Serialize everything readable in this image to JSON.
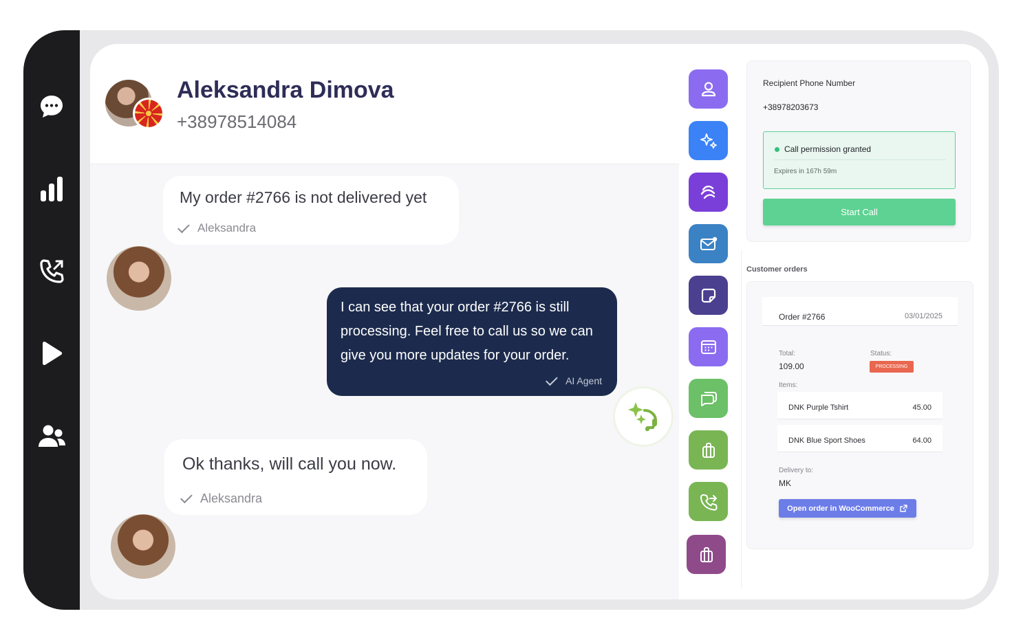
{
  "rail": {
    "icons": [
      "chat-bubble-icon",
      "bar-chart-icon",
      "phone-outgoing-icon",
      "play-icon",
      "users-icon"
    ]
  },
  "contact": {
    "name": "Aleksandra Dimova",
    "phone": "+38978514084"
  },
  "messages": [
    {
      "text": "My order #2766 is not delivered yet",
      "sender": "Aleksandra"
    },
    {
      "text": "I can see that your order #2766 is still processing. Feel free to call us so we can give you more updates for your order.",
      "sender": "AI Agent"
    },
    {
      "text": "Ok thanks, will call you now.",
      "sender": "Aleksandra"
    }
  ],
  "apps": [
    {
      "icon": "user-icon",
      "color": "#8b6cf0"
    },
    {
      "icon": "sparkles-icon",
      "color": "#3b82f6"
    },
    {
      "icon": "stripe-icon",
      "color": "#7b3fd9"
    },
    {
      "icon": "mail-icon",
      "color": "#3b82c4"
    },
    {
      "icon": "sticky-note-icon",
      "color": "#4b3f8f"
    },
    {
      "icon": "calendar-icon",
      "color": "#8b6cf0"
    },
    {
      "icon": "chat-icon",
      "color": "#6cc067"
    },
    {
      "icon": "gift-icon",
      "color": "#7ab554"
    },
    {
      "icon": "phone-forward-icon",
      "color": "#7ab554"
    },
    {
      "icon": "gift-icon",
      "color": "#8f4a8a"
    }
  ],
  "call": {
    "recipient_label": "Recipient Phone Number",
    "recipient_phone": "+38978203673",
    "permission": "Call permission granted",
    "expires": "Expires in 167h 59m",
    "button": "Start Call"
  },
  "orders": {
    "title": "Customer orders",
    "order_id": "Order #2766",
    "date": "03/01/2025",
    "total_label": "Total:",
    "total": "109.00",
    "status_label": "Status:",
    "status": "PROCESSING",
    "items_label": "Items:",
    "items": [
      {
        "name": "DNK Purple Tshirt",
        "price": "45.00"
      },
      {
        "name": "DNK Blue Sport Shoes",
        "price": "64.00"
      }
    ],
    "delivery_label": "Delivery to:",
    "delivery": "MK",
    "woo_button": "Open order in WooCommerce"
  }
}
